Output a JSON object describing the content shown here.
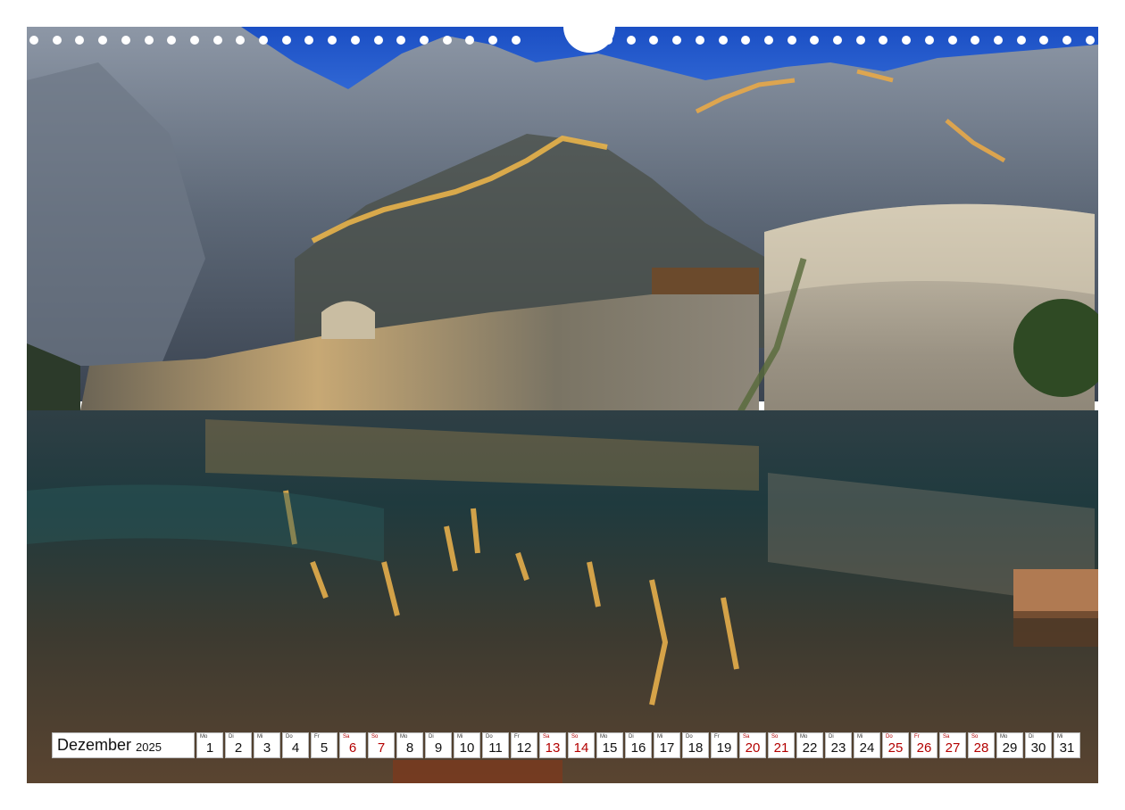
{
  "calendar": {
    "month": "Dezember",
    "year": "2025",
    "days": [
      {
        "wd": "Mo",
        "n": "1",
        "we": false
      },
      {
        "wd": "Di",
        "n": "2",
        "we": false
      },
      {
        "wd": "Mi",
        "n": "3",
        "we": false
      },
      {
        "wd": "Do",
        "n": "4",
        "we": false
      },
      {
        "wd": "Fr",
        "n": "5",
        "we": false
      },
      {
        "wd": "Sa",
        "n": "6",
        "we": true
      },
      {
        "wd": "So",
        "n": "7",
        "we": true
      },
      {
        "wd": "Mo",
        "n": "8",
        "we": false
      },
      {
        "wd": "Di",
        "n": "9",
        "we": false
      },
      {
        "wd": "Mi",
        "n": "10",
        "we": false
      },
      {
        "wd": "Do",
        "n": "11",
        "we": false
      },
      {
        "wd": "Fr",
        "n": "12",
        "we": false
      },
      {
        "wd": "Sa",
        "n": "13",
        "we": true
      },
      {
        "wd": "So",
        "n": "14",
        "we": true
      },
      {
        "wd": "Mo",
        "n": "15",
        "we": false
      },
      {
        "wd": "Di",
        "n": "16",
        "we": false
      },
      {
        "wd": "Mi",
        "n": "17",
        "we": false
      },
      {
        "wd": "Do",
        "n": "18",
        "we": false
      },
      {
        "wd": "Fr",
        "n": "19",
        "we": false
      },
      {
        "wd": "Sa",
        "n": "20",
        "we": true
      },
      {
        "wd": "So",
        "n": "21",
        "we": true
      },
      {
        "wd": "Mo",
        "n": "22",
        "we": false
      },
      {
        "wd": "Di",
        "n": "23",
        "we": false
      },
      {
        "wd": "Mi",
        "n": "24",
        "we": false
      },
      {
        "wd": "Do",
        "n": "25",
        "we": true
      },
      {
        "wd": "Fr",
        "n": "26",
        "we": true
      },
      {
        "wd": "Sa",
        "n": "27",
        "we": true
      },
      {
        "wd": "So",
        "n": "28",
        "we": true
      },
      {
        "wd": "Mo",
        "n": "29",
        "we": false
      },
      {
        "wd": "Di",
        "n": "30",
        "we": false
      },
      {
        "wd": "Mi",
        "n": "31",
        "we": false
      }
    ]
  },
  "colors": {
    "weekend_text": "#b30000",
    "sky": "#1f55c9"
  }
}
